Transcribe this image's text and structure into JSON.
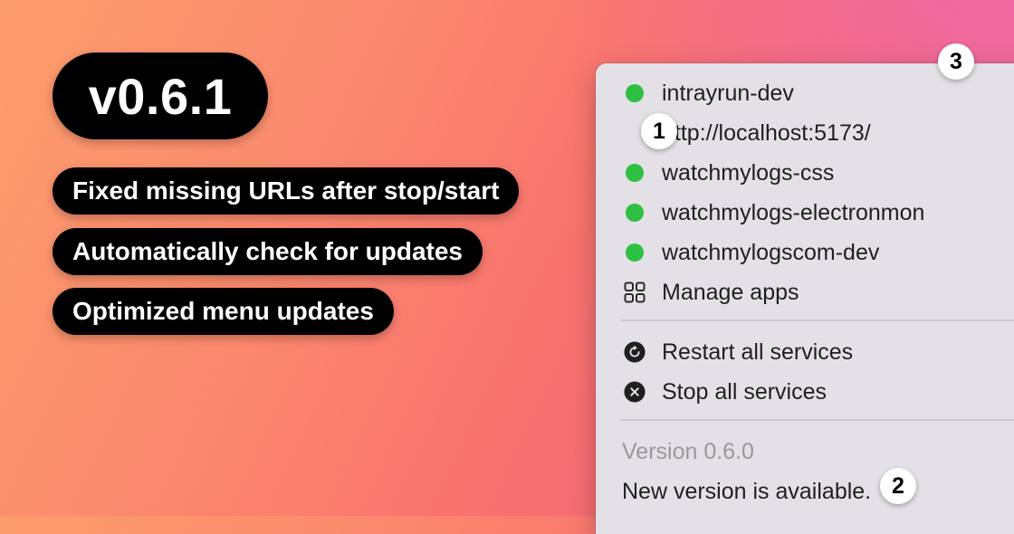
{
  "release": {
    "version_label": "v0.6.1",
    "features": [
      "Fixed missing URLs after stop/start",
      "Automatically check for updates",
      "Optimized menu updates"
    ]
  },
  "menu": {
    "apps": [
      {
        "name": "intrayrun-dev",
        "status": "running",
        "status_color": "#2ec042"
      },
      {
        "name": "watchmylogs-css",
        "status": "running",
        "status_color": "#2ec042"
      },
      {
        "name": "watchmylogs-electronmon",
        "status": "running",
        "status_color": "#2ec042"
      },
      {
        "name": "watchmylogscom-dev",
        "status": "running",
        "status_color": "#2ec042"
      }
    ],
    "app_url": "http://localhost:5173/",
    "manage_apps_label": "Manage apps",
    "manage_apps_icon": "grid-icon",
    "restart_label": "Restart all services",
    "restart_icon": "restart-icon",
    "stop_label": "Stop all services",
    "stop_icon": "stop-icon",
    "version_label": "Version 0.6.0",
    "update_label": "New version is available."
  },
  "callouts": [
    "1",
    "2",
    "3"
  ]
}
